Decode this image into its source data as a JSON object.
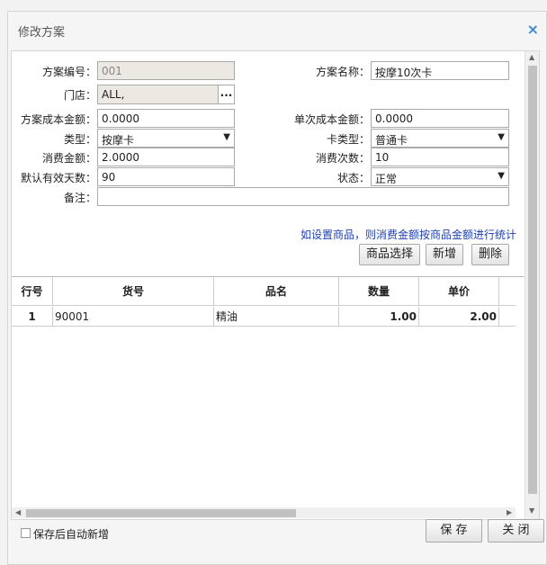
{
  "dialog": {
    "title": "修改方案",
    "close_icon": "×"
  },
  "form": {
    "plan_no_label": "方案编号：",
    "plan_no_value": "001",
    "plan_name_label": "方案名称：",
    "plan_name_value": "按摩10次卡",
    "store_label": "门店：",
    "store_value": "ALL,",
    "store_btn": "...",
    "cost_label": "方案成本金额：",
    "cost_value": "0.0000",
    "unit_cost_label": "单次成本金额：",
    "unit_cost_value": "0.0000",
    "type_label": "类型：",
    "type_value": "按摩卡",
    "card_type_label": "卡类型：",
    "card_type_value": "普通卡",
    "consume_amount_label": "消费金额：",
    "consume_amount_value": "2.0000",
    "consume_times_label": "消费次数：",
    "consume_times_value": "10",
    "valid_days_label": "默认有效天数：",
    "valid_days_value": "90",
    "status_label": "状态：",
    "status_value": "正常",
    "remark_label": "备注：",
    "remark_value": ""
  },
  "note": "如设置商品，则消费金额按商品金额进行统计",
  "toolbar": {
    "select_goods": "商品选择",
    "add": "新增",
    "delete": "删除"
  },
  "table": {
    "headers": [
      "行号",
      "货号",
      "品名",
      "数量",
      "单价"
    ],
    "rows": [
      {
        "line": "1",
        "code": "90001",
        "name": "精油",
        "qty": "1.00",
        "price": "2.00"
      }
    ]
  },
  "footer": {
    "auto_add_label": "保存后自动新增",
    "save": "保 存",
    "close": "关 闭"
  },
  "icons": {
    "dropdown": "chevron-down-icon",
    "scroll_up": "triangle-up-icon",
    "scroll_down": "triangle-down-icon"
  }
}
